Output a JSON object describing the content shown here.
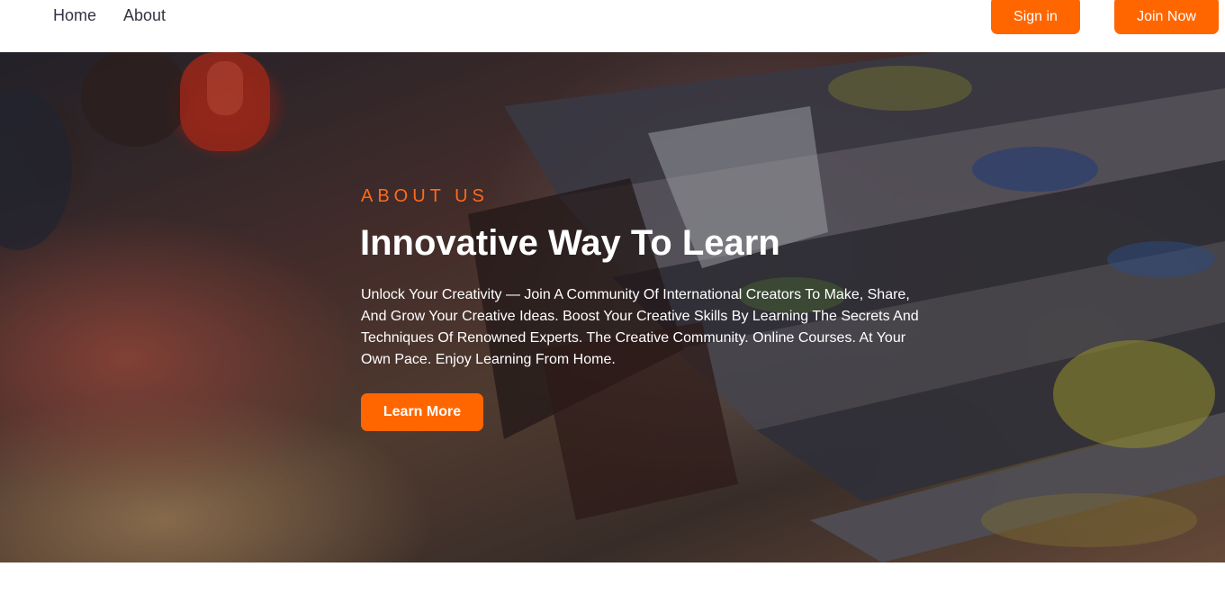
{
  "nav": {
    "home_label": "Home",
    "about_label": "About",
    "signin_label": "Sign in",
    "join_label": "Join Now"
  },
  "hero": {
    "eyebrow": "ABOUT US",
    "title": "Innovative Way To Learn",
    "description": "Unlock Your Creativity — Join A Community Of International Creators To Make, Share, And Grow Your Creative Ideas. Boost Your Creative Skills By Learning The Secrets And Techniques Of Renowned Experts. The Creative Community. Online Courses. At Your Own Pace. Enjoy Learning From Home.",
    "button_label": "Learn More",
    "background_image": "paint-brushes-photo"
  },
  "colors": {
    "accent": "#ff6600",
    "nav_text": "#333344",
    "hero_text": "#ffffff"
  }
}
